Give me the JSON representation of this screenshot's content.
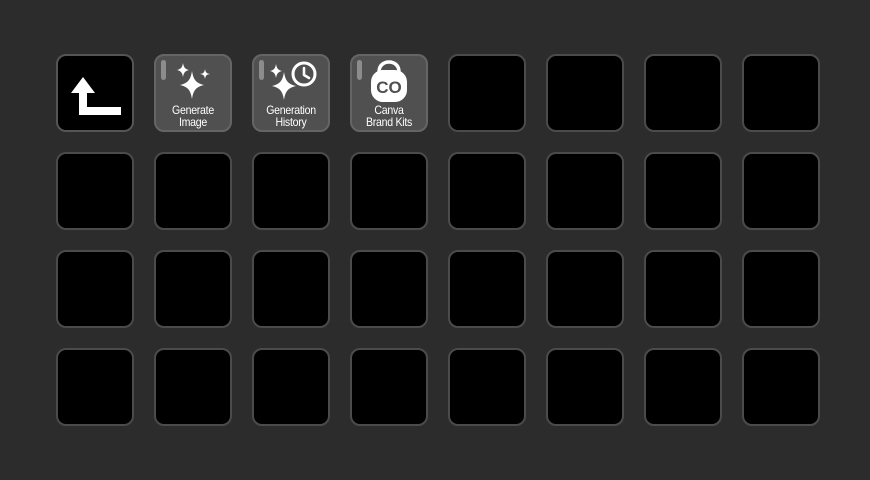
{
  "keys": [
    {
      "type": "back",
      "icon": "back-arrow-icon"
    },
    {
      "type": "action",
      "icon": "sparkles-icon",
      "label_line1": "Generate",
      "label_line2": "Image"
    },
    {
      "type": "action",
      "icon": "sparkles-clock-icon",
      "label_line1": "Generation",
      "label_line2": "History"
    },
    {
      "type": "action",
      "icon": "canva-brand-kit-icon",
      "label_line1": "Canva",
      "label_line2": "Brand Kits"
    }
  ],
  "canva_logo_text": "CO",
  "grid": {
    "columns": 8,
    "rows": 4
  },
  "colors": {
    "background": "#2c2c2c",
    "empty_key": "#000000",
    "action_key": "#505050",
    "indicator": "#8c8c8c"
  }
}
